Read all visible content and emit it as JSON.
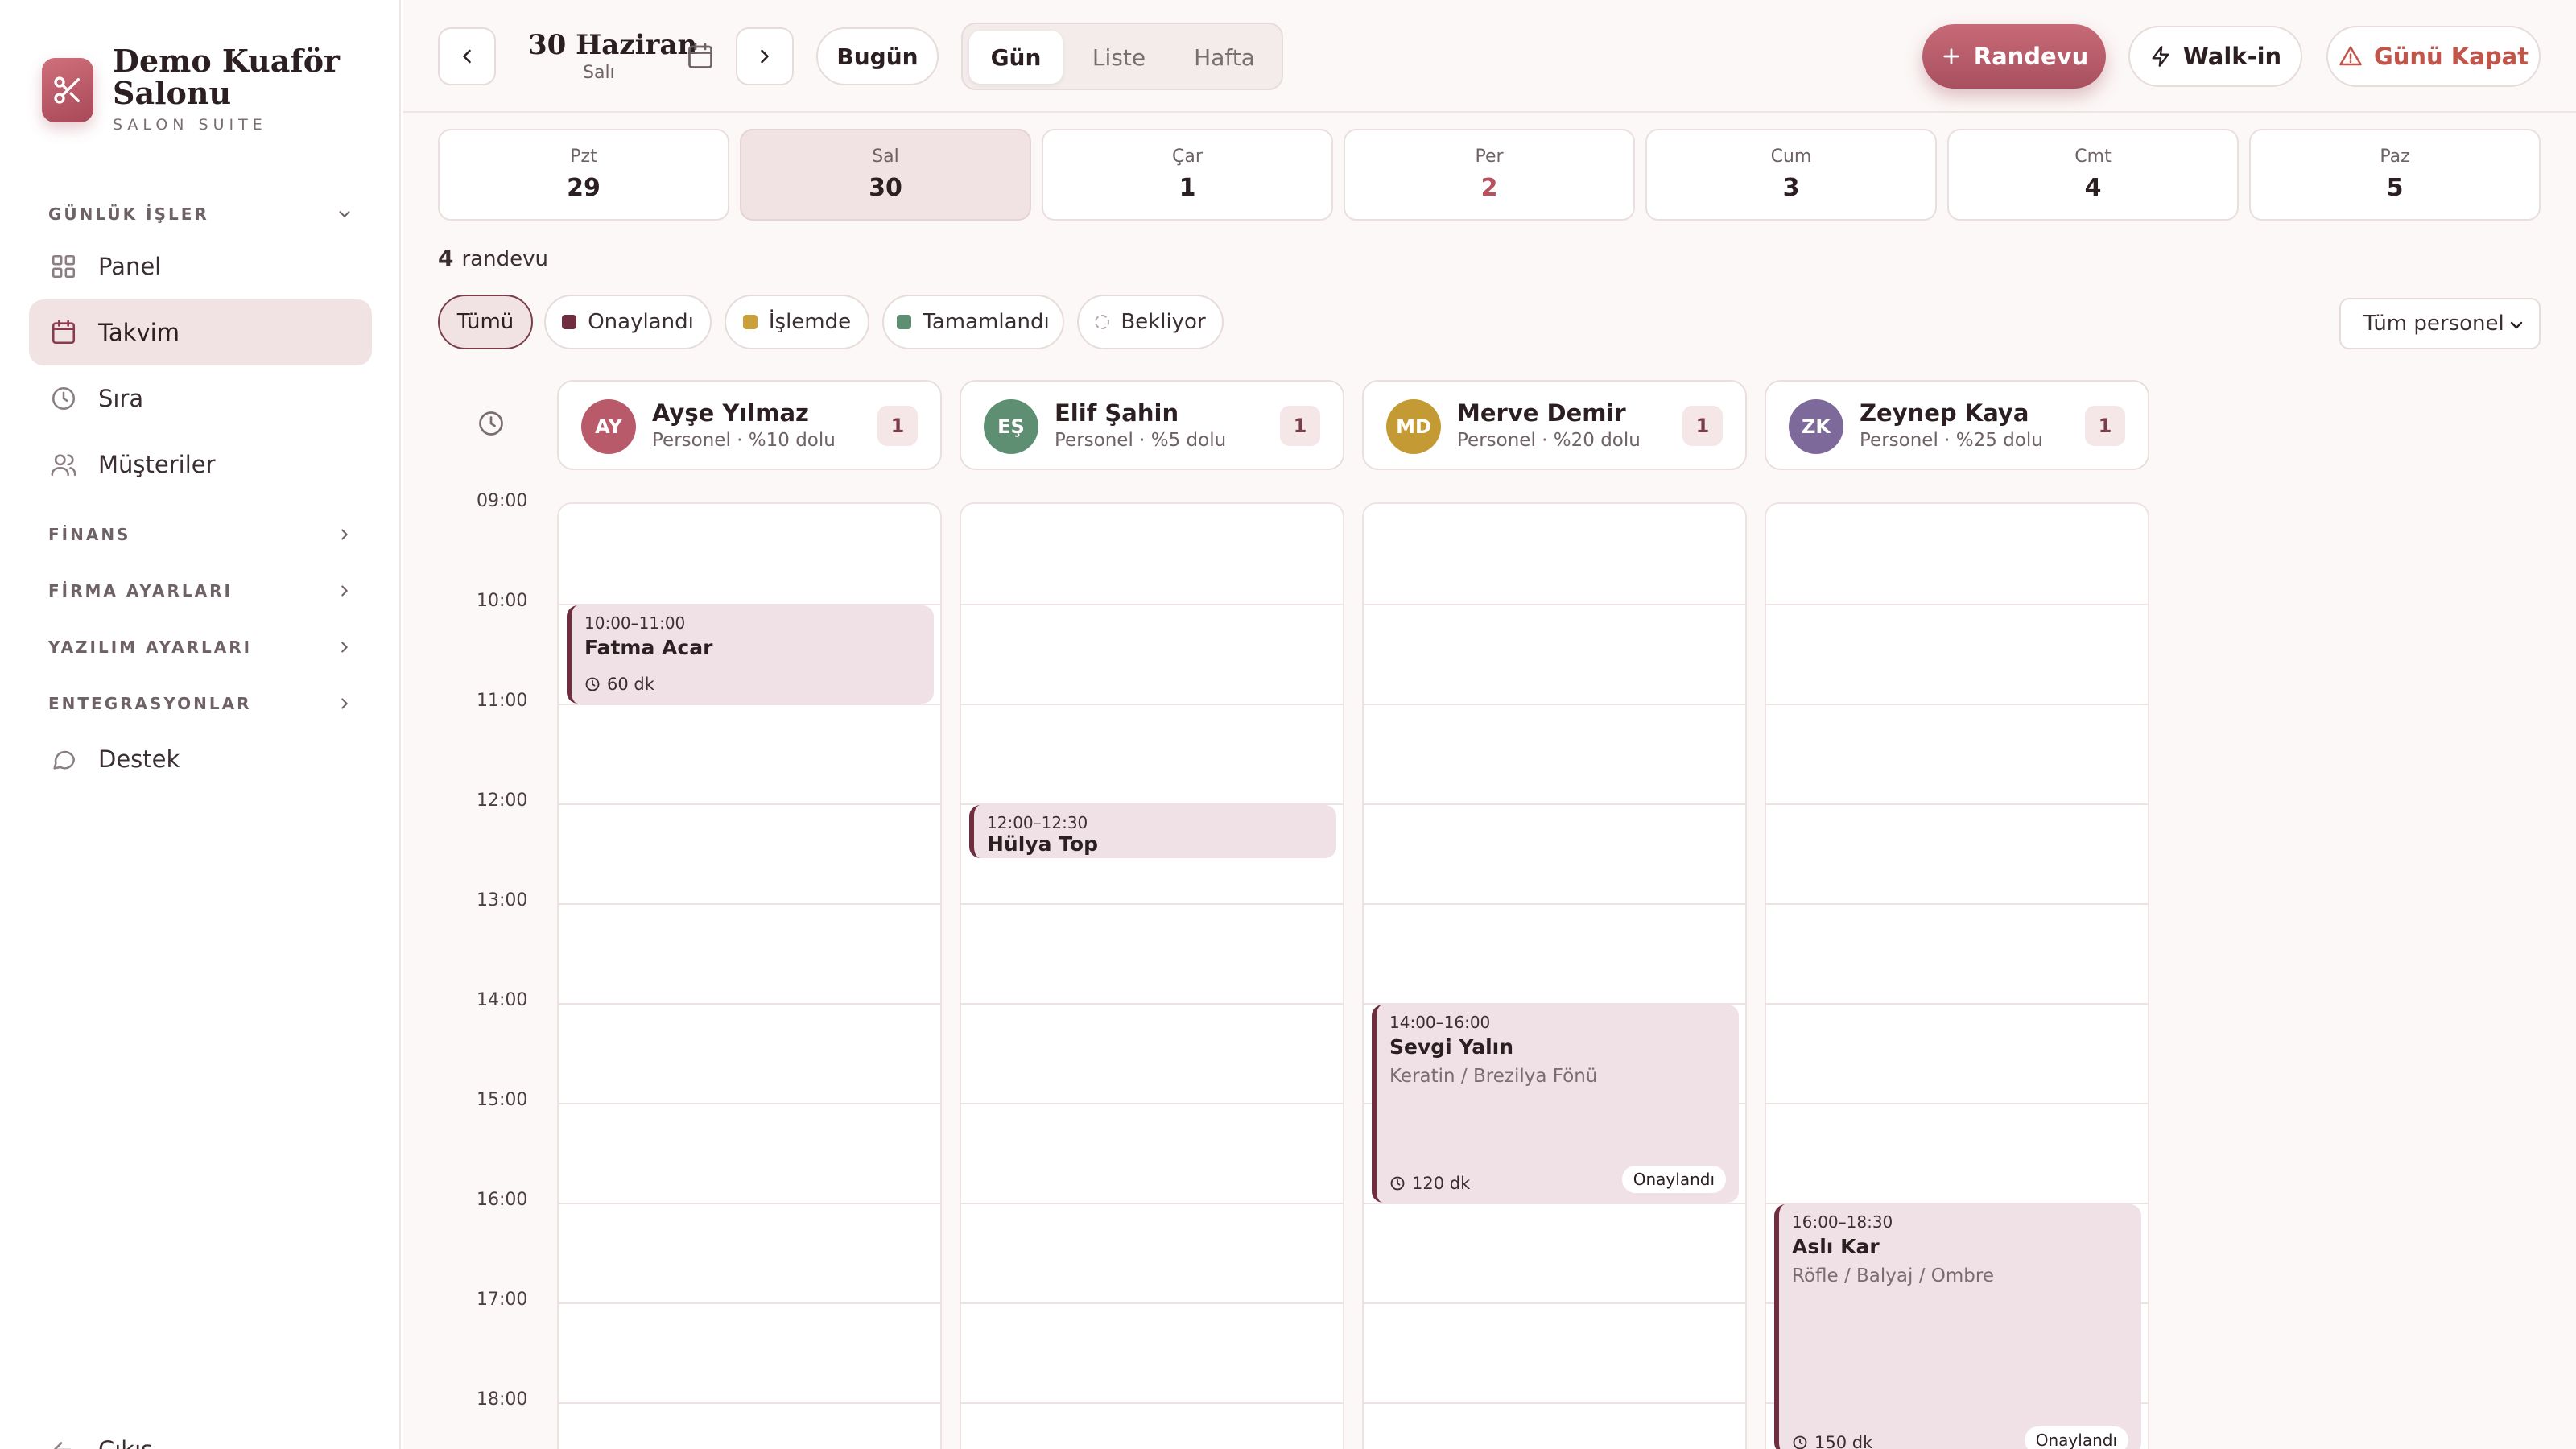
{
  "brand": {
    "title": "Demo Kuaför Salonu",
    "subtitle": "SALON SUITE"
  },
  "sidebar": {
    "sections": [
      {
        "label": "GÜNLÜK İŞLER",
        "expanded": true
      },
      {
        "label": "FİNANS",
        "expanded": false
      },
      {
        "label": "FİRMA AYARLARI",
        "expanded": false
      },
      {
        "label": "YAZILIM AYARLARI",
        "expanded": false
      },
      {
        "label": "ENTEGRASYONLAR",
        "expanded": false
      }
    ],
    "items": [
      {
        "label": "Panel",
        "icon": "grid-icon",
        "active": false
      },
      {
        "label": "Takvim",
        "icon": "calendar-icon",
        "active": true
      },
      {
        "label": "Sıra",
        "icon": "clock-icon",
        "active": false
      },
      {
        "label": "Müşteriler",
        "icon": "users-icon",
        "active": false
      },
      {
        "label": "Destek",
        "icon": "chat-icon",
        "active": false
      }
    ],
    "logout": "Çıkış"
  },
  "topbar": {
    "date": "30 Haziran",
    "weekday": "Salı",
    "today_label": "Bugün",
    "views": [
      "Gün",
      "Liste",
      "Hafta"
    ],
    "active_view": "Gün",
    "new_appointment": "Randevu",
    "walkin": "Walk-in",
    "close_day": "Günü Kapat"
  },
  "days": [
    {
      "name": "Pzt",
      "num": "29"
    },
    {
      "name": "Sal",
      "num": "30",
      "active": true
    },
    {
      "name": "Çar",
      "num": "1"
    },
    {
      "name": "Per",
      "num": "2",
      "highlight": true
    },
    {
      "name": "Cum",
      "num": "3"
    },
    {
      "name": "Cmt",
      "num": "4"
    },
    {
      "name": "Paz",
      "num": "5"
    }
  ],
  "summary": {
    "count": "4",
    "label": "randevu"
  },
  "filters": [
    {
      "label": "Tümü",
      "active": true
    },
    {
      "label": "Onaylandı",
      "color": "#6e2e40"
    },
    {
      "label": "İşlemde",
      "color": "#c9a03a"
    },
    {
      "label": "Tamamlandı",
      "color": "#5f8f72"
    },
    {
      "label": "Bekliyor",
      "color": "dashed"
    }
  ],
  "staff_filter": "Tüm personel",
  "hours": [
    "09:00",
    "10:00",
    "11:00",
    "12:00",
    "13:00",
    "14:00",
    "15:00",
    "16:00",
    "17:00",
    "18:00"
  ],
  "staff": [
    {
      "initials": "AY",
      "name": "Ayşe Yılmaz",
      "meta": "Personel · %10 dolu",
      "count": "1",
      "color": "#b85a6a"
    },
    {
      "initials": "EŞ",
      "name": "Elif Şahin",
      "meta": "Personel · %5 dolu",
      "count": "1",
      "color": "#5f8f72"
    },
    {
      "initials": "MD",
      "name": "Merve Demir",
      "meta": "Personel · %20 dolu",
      "count": "1",
      "color": "#c39a33"
    },
    {
      "initials": "ZK",
      "name": "Zeynep Kaya",
      "meta": "Personel · %25 dolu",
      "count": "1",
      "color": "#7e6a9a"
    }
  ],
  "appointments": [
    {
      "time": "10:00–11:00",
      "name": "Fatma Acar",
      "service": "",
      "duration": "60 dk",
      "status": ""
    },
    {
      "time": "12:00–12:30",
      "name": "Hülya Top",
      "service": "",
      "duration": "",
      "status": ""
    },
    {
      "time": "14:00–16:00",
      "name": "Sevgi Yalın",
      "service": "Keratin / Brezilya Fönü",
      "duration": "120 dk",
      "status": "Onaylandı"
    },
    {
      "time": "16:00–18:30",
      "name": "Aslı Kar",
      "service": "Röfle / Balyaj / Ombre",
      "duration": "150 dk",
      "status": "Onaylandı"
    }
  ]
}
